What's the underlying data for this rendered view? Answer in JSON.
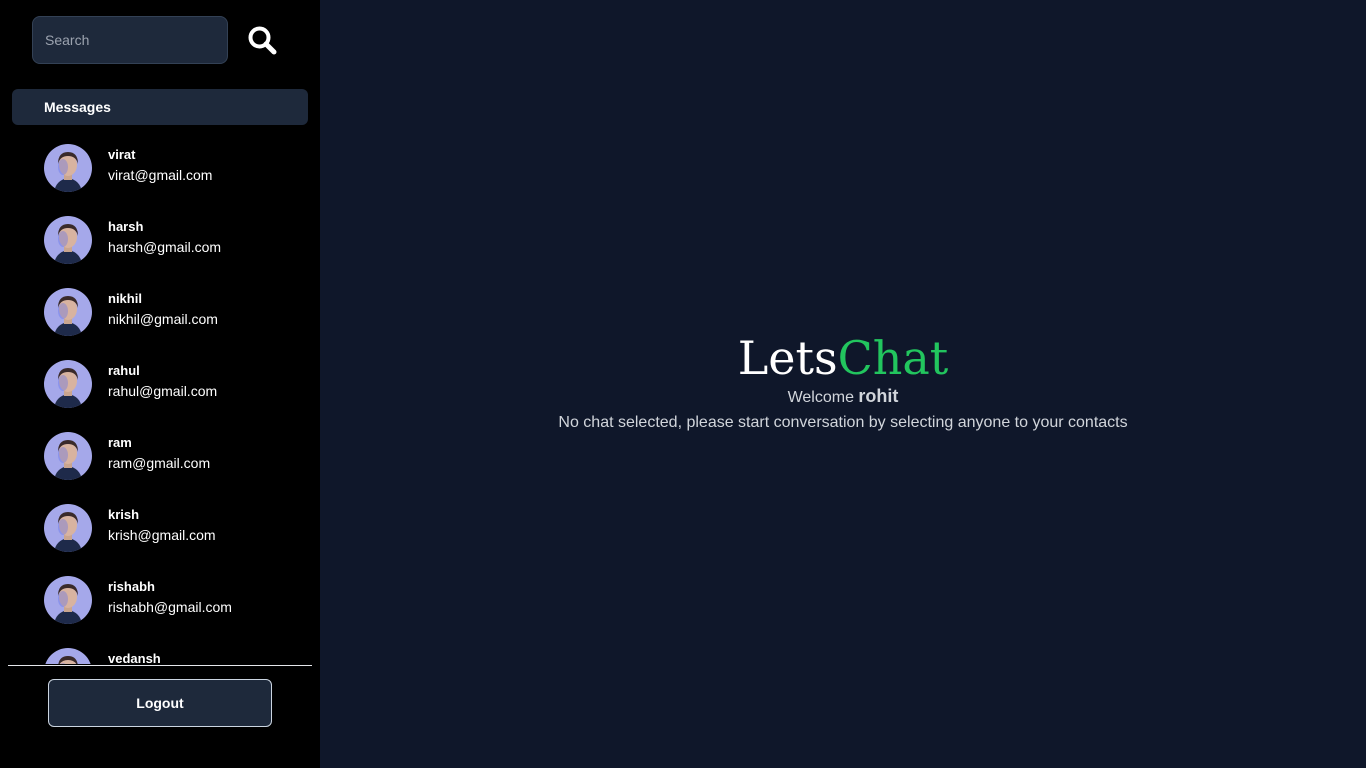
{
  "search": {
    "placeholder": "Search"
  },
  "sidebar": {
    "header": "Messages",
    "contacts": [
      {
        "name": "virat",
        "email": "virat@gmail.com"
      },
      {
        "name": "harsh",
        "email": "harsh@gmail.com"
      },
      {
        "name": "nikhil",
        "email": "nikhil@gmail.com"
      },
      {
        "name": "rahul",
        "email": "rahul@gmail.com"
      },
      {
        "name": "ram",
        "email": "ram@gmail.com"
      },
      {
        "name": "krish",
        "email": "krish@gmail.com"
      },
      {
        "name": "rishabh",
        "email": "rishabh@gmail.com"
      },
      {
        "name": "vedansh",
        "email": ""
      }
    ],
    "logout_label": "Logout"
  },
  "main": {
    "brand_part1": "Lets",
    "brand_part2": "Chat",
    "welcome_prefix": "Welcome",
    "welcome_user": "rohit",
    "empty_message": "No chat selected, please start conversation by selecting anyone to your contacts"
  },
  "colors": {
    "sidebar_bg": "#000000",
    "main_bg": "#0f172a",
    "panel": "#1e293b",
    "accent_green": "#22c55e"
  },
  "icons": [
    "search-icon",
    "avatar"
  ]
}
